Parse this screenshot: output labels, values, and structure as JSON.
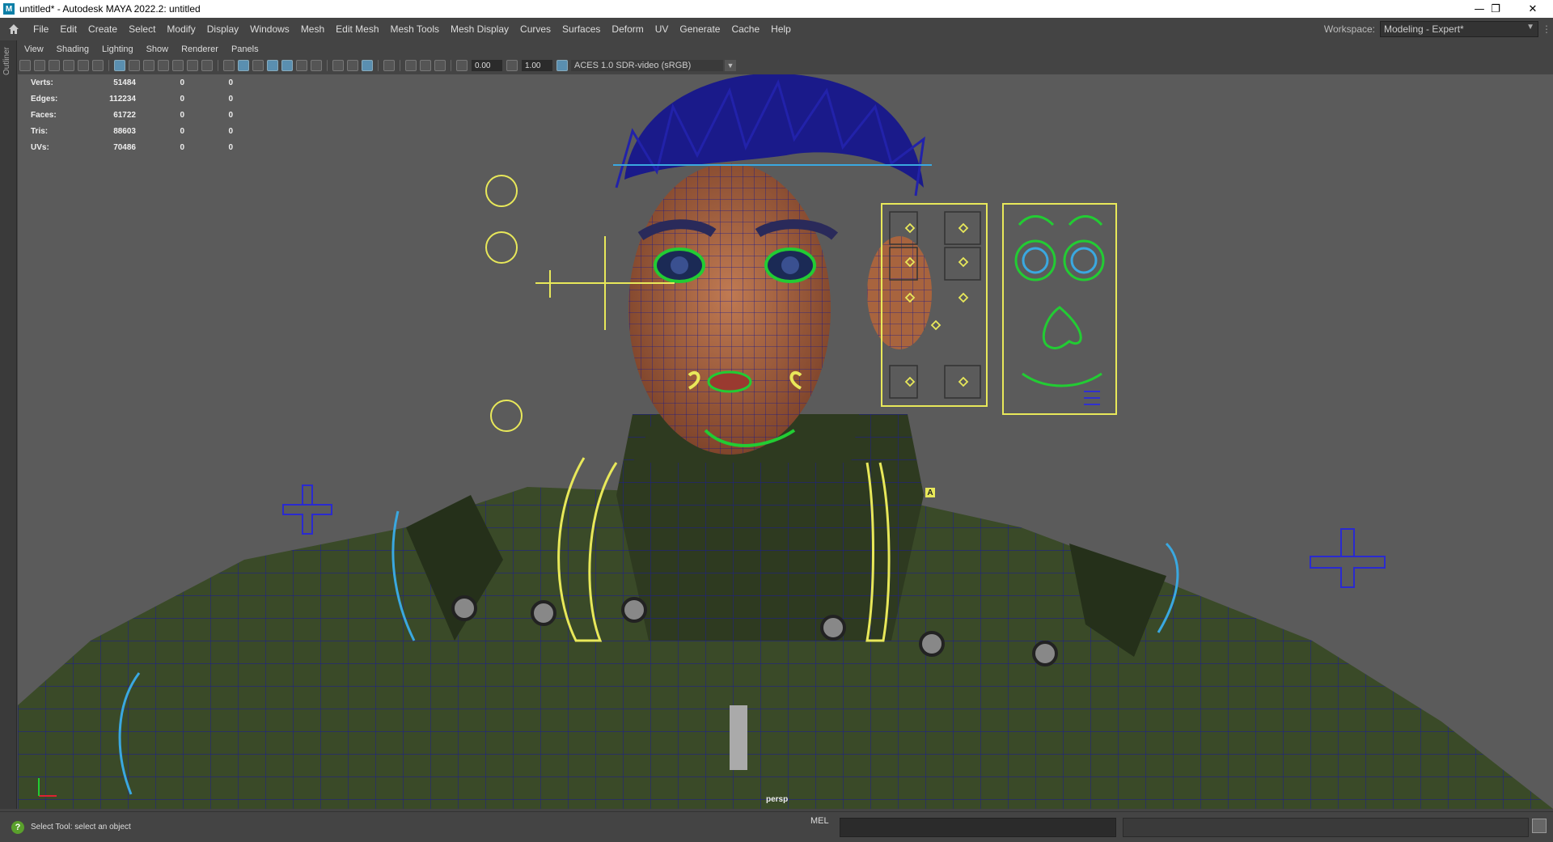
{
  "window": {
    "title": "untitled* - Autodesk MAYA 2022.2: untitled",
    "app_icon_letter": "M",
    "minimize": "—",
    "restore": "❐",
    "close": "✕"
  },
  "menubar": {
    "items": [
      "File",
      "Edit",
      "Create",
      "Select",
      "Modify",
      "Display",
      "Windows",
      "Mesh",
      "Edit Mesh",
      "Mesh Tools",
      "Mesh Display",
      "Curves",
      "Surfaces",
      "Deform",
      "UV",
      "Generate",
      "Cache",
      "Help"
    ]
  },
  "workspace": {
    "label": "Workspace:",
    "value": "Modeling - Expert*"
  },
  "outliner": {
    "label": "Outliner"
  },
  "panel_menu": {
    "items": [
      "View",
      "Shading",
      "Lighting",
      "Show",
      "Renderer",
      "Panels"
    ]
  },
  "toolbar": {
    "exposure": "0.00",
    "gamma": "1.00",
    "color_management": "ACES 1.0 SDR-video (sRGB)"
  },
  "hud": {
    "rows": [
      {
        "label": "Verts:",
        "value": "51484",
        "c1": "0",
        "c2": "0"
      },
      {
        "label": "Edges:",
        "value": "112234",
        "c1": "0",
        "c2": "0"
      },
      {
        "label": "Faces:",
        "value": "61722",
        "c1": "0",
        "c2": "0"
      },
      {
        "label": "Tris:",
        "value": "88603",
        "c1": "0",
        "c2": "0"
      },
      {
        "label": "UVs:",
        "value": "70486",
        "c1": "0",
        "c2": "0"
      }
    ]
  },
  "viewport": {
    "camera": "persp",
    "face_panel_letter": "A"
  },
  "colors": {
    "wire_blue": "#1a1aa8",
    "ctrl_yellow": "#e8e85a",
    "ctrl_green": "#22cc33",
    "ctrl_cyan": "#3aa8e0",
    "ctrl_red": "#dd2233"
  },
  "status": {
    "help_icon": "?",
    "message": "Select Tool: select an object",
    "mel_label": "MEL"
  }
}
